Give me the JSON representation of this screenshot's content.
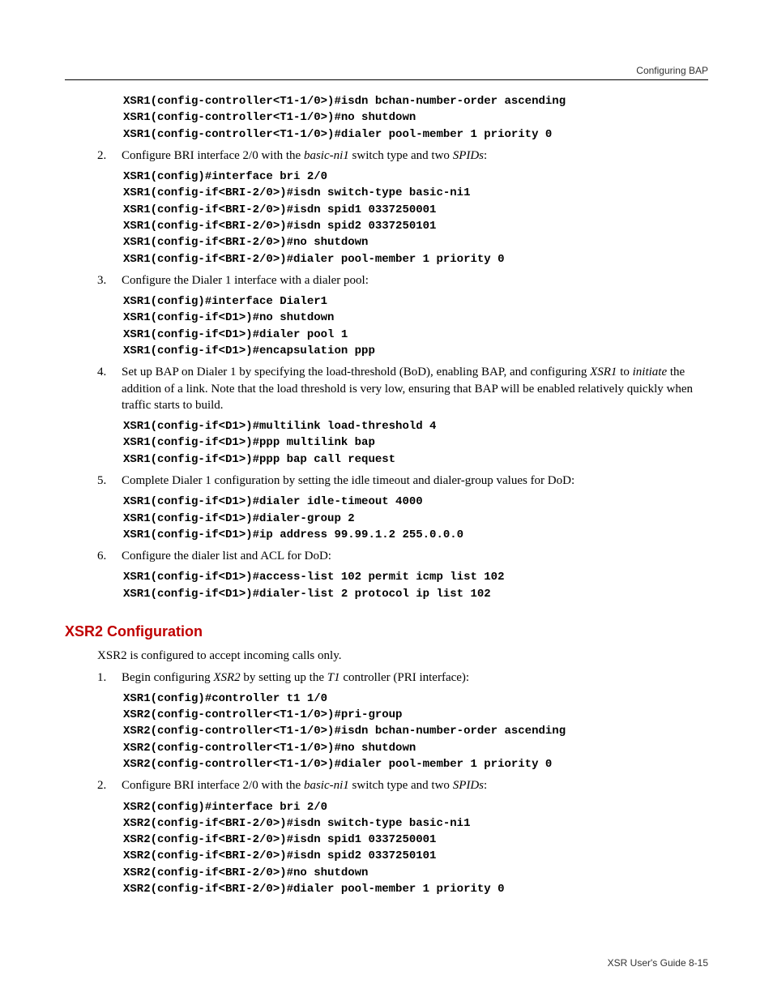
{
  "header": {
    "right": "Configuring BAP"
  },
  "codeA": "XSR1(config-controller<T1-1/0>)#isdn bchan-number-order ascending\nXSR1(config-controller<T1-1/0>)#no shutdown\nXSR1(config-controller<T1-1/0>)#dialer pool-member 1 priority 0",
  "step2": {
    "num": "2.",
    "a": "Configure BRI interface 2/0 with the ",
    "i1": "basic-ni1",
    "b": " switch type and two ",
    "i2": "SPIDs",
    "c": ":"
  },
  "codeB": "XSR1(config)#interface bri 2/0\nXSR1(config-if<BRI-2/0>)#isdn switch-type basic-ni1\nXSR1(config-if<BRI-2/0>)#isdn spid1 0337250001\nXSR1(config-if<BRI-2/0>)#isdn spid2 0337250101\nXSR1(config-if<BRI-2/0>)#no shutdown\nXSR1(config-if<BRI-2/0>)#dialer pool-member 1 priority 0",
  "step3": {
    "num": "3.",
    "txt": "Configure the Dialer 1 interface with a dialer pool:"
  },
  "codeC": "XSR1(config)#interface Dialer1\nXSR1(config-if<D1>)#no shutdown\nXSR1(config-if<D1>)#dialer pool 1\nXSR1(config-if<D1>)#encapsulation ppp",
  "step4": {
    "num": "4.",
    "a": "Set up BAP on Dialer 1 by specifying the load-threshold (BoD), enabling BAP, and configuring ",
    "i1": "XSR1",
    "b": " to ",
    "i2": "initiate",
    "c": " the addition of a link. Note that the load threshold is very low, ensuring that BAP will be enabled relatively quickly when traffic starts to build."
  },
  "codeD": "XSR1(config-if<D1>)#multilink load-threshold 4\nXSR1(config-if<D1>)#ppp multilink bap\nXSR1(config-if<D1>)#ppp bap call request",
  "step5": {
    "num": "5.",
    "txt": "Complete Dialer 1 configuration by setting the idle timeout and dialer-group values for DoD:"
  },
  "codeE": "XSR1(config-if<D1>)#dialer idle-timeout 4000\nXSR1(config-if<D1>)#dialer-group 2\nXSR1(config-if<D1>)#ip address 99.99.1.2 255.0.0.0",
  "step6": {
    "num": "6.",
    "txt": "Configure the dialer list and ACL for DoD:"
  },
  "codeF": "XSR1(config-if<D1>)#access-list 102 permit icmp list 102\nXSR1(config-if<D1>)#dialer-list 2 protocol ip list 102",
  "h2": "XSR2 Configuration",
  "intro2": "XSR2 is configured to accept incoming calls only.",
  "stepB1": {
    "num": "1.",
    "a": "Begin configuring ",
    "i1": "XSR2",
    "b": " by setting up the ",
    "i2": "T1",
    "c": " controller (PRI interface):"
  },
  "codeG": "XSR1(config)#controller t1 1/0\nXSR2(config-controller<T1-1/0>)#pri-group\nXSR2(config-controller<T1-1/0>)#isdn bchan-number-order ascending\nXSR2(config-controller<T1-1/0>)#no shutdown\nXSR2(config-controller<T1-1/0>)#dialer pool-member 1 priority 0",
  "stepB2": {
    "num": "2.",
    "a": "Configure BRI interface 2/0 with the ",
    "i1": "basic-ni1",
    "b": " switch type and two ",
    "i2": "SPIDs",
    "c": ":"
  },
  "codeH": "XSR2(config)#interface bri 2/0\nXSR2(config-if<BRI-2/0>)#isdn switch-type basic-ni1\nXSR2(config-if<BRI-2/0>)#isdn spid1 0337250001\nXSR2(config-if<BRI-2/0>)#isdn spid2 0337250101\nXSR2(config-if<BRI-2/0>)#no shutdown\nXSR2(config-if<BRI-2/0>)#dialer pool-member 1 priority 0",
  "footer": "XSR User's Guide   8-15"
}
